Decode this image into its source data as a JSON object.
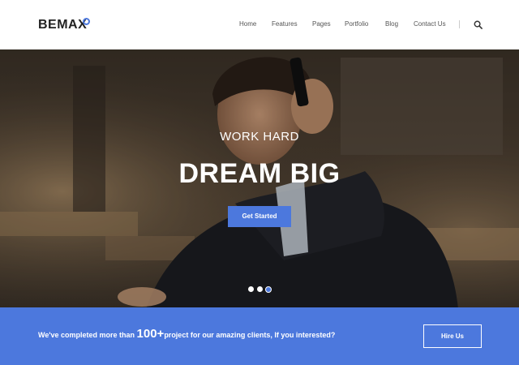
{
  "brand": {
    "name": "BEMAX",
    "accent": "#4c78dd"
  },
  "nav": {
    "items": [
      "Home",
      "Features",
      "Pages",
      "Portfolio",
      "Blog",
      "Contact Us"
    ],
    "search_icon": "search-icon"
  },
  "hero": {
    "subtitle": "WORK HARD",
    "title": "DREAM BIG",
    "cta_label": "Get Started",
    "slides": {
      "count": 3,
      "active": 3
    }
  },
  "banner": {
    "text_before": "We've completed more than ",
    "highlight": "100+",
    "text_after": "project for our amazing clients, If you interested?",
    "button_label": "Hire Us"
  }
}
